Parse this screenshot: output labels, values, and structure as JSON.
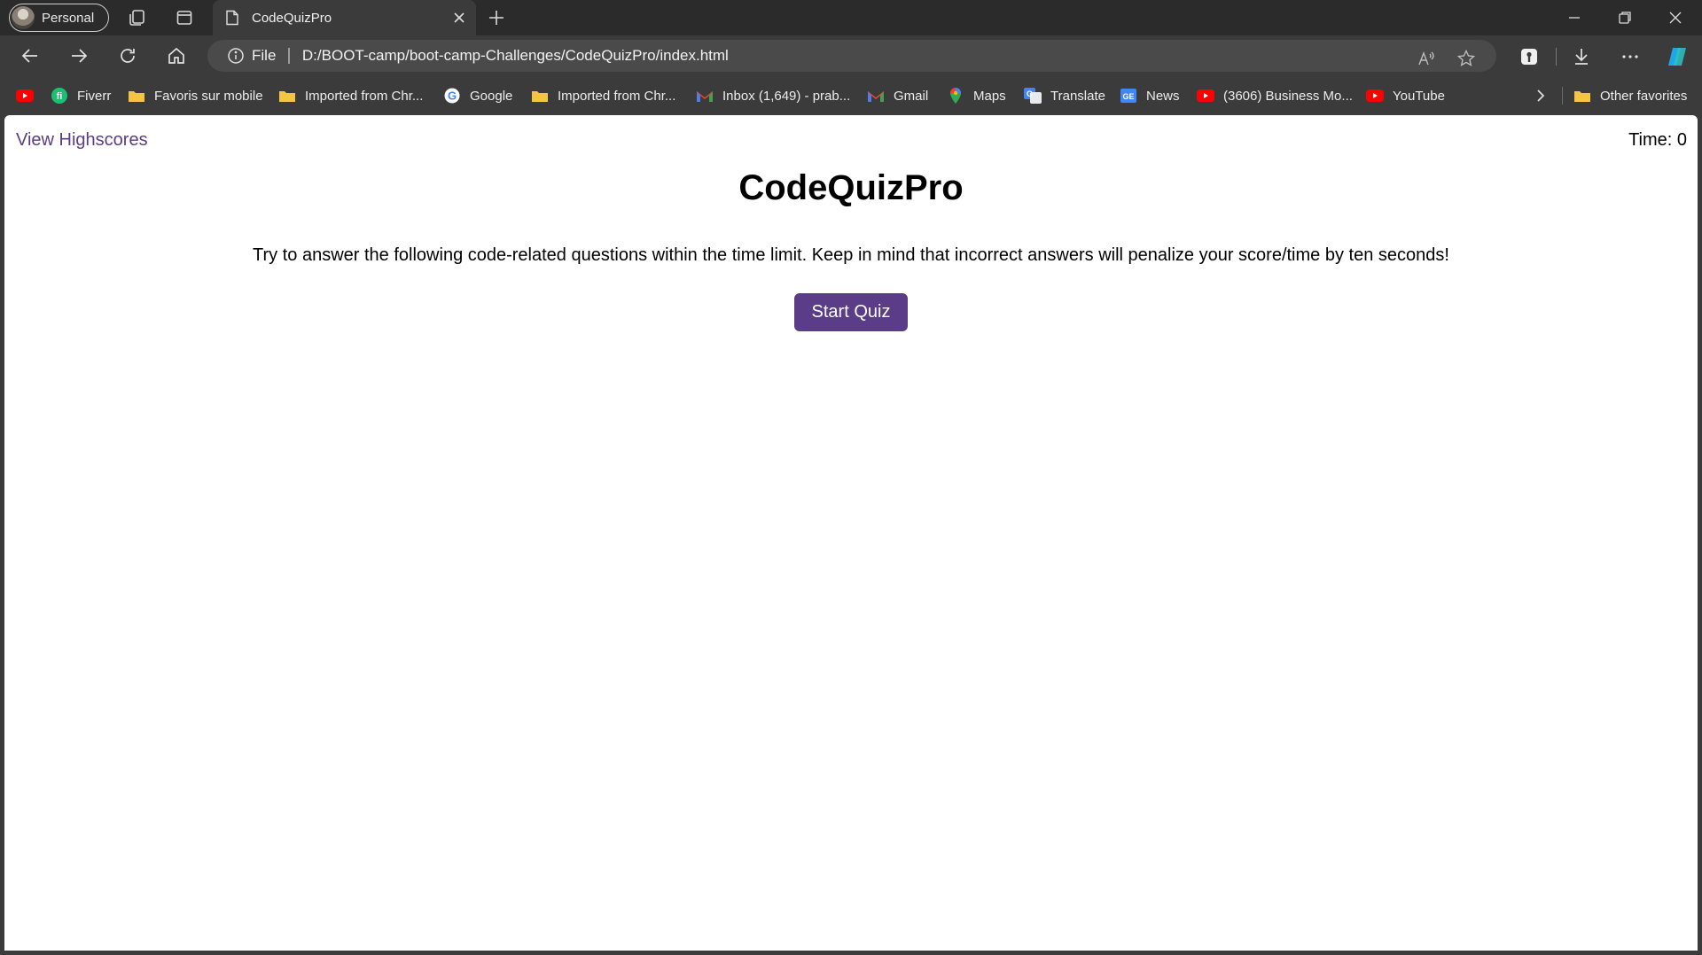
{
  "browser": {
    "profile_label": "Personal",
    "tab_title": "CodeQuizPro",
    "address": {
      "scheme_label": "File",
      "url": "D:/BOOT-camp/boot-camp-Challenges/CodeQuizPro/index.html"
    },
    "bookmarks": [
      {
        "label": "",
        "icon": "youtube-icon"
      },
      {
        "label": "Fiverr",
        "icon": "fiverr-icon"
      },
      {
        "label": "Favoris sur mobile",
        "icon": "folder-icon"
      },
      {
        "label": "Imported from Chr...",
        "icon": "folder-icon"
      },
      {
        "label": "Google",
        "icon": "google-icon"
      },
      {
        "label": "Imported from Chr...",
        "icon": "folder-icon"
      },
      {
        "label": "Inbox (1,649) - prab...",
        "icon": "gmail-icon"
      },
      {
        "label": "Gmail",
        "icon": "gmail-icon"
      },
      {
        "label": "Maps",
        "icon": "maps-icon"
      },
      {
        "label": "Translate",
        "icon": "translate-icon"
      },
      {
        "label": "News",
        "icon": "news-icon"
      },
      {
        "label": "(3606) Business Mo...",
        "icon": "youtube-icon"
      },
      {
        "label": "YouTube",
        "icon": "youtube-icon"
      }
    ],
    "other_favorites_label": "Other favorites"
  },
  "page": {
    "highscores_link": "View Highscores",
    "timer_text": "Time: 0",
    "title": "CodeQuizPro",
    "description": "Try to answer the following code-related questions within the time limit. Keep in mind that incorrect answers will penalize your score/time by ten seconds!",
    "start_button": "Start Quiz"
  },
  "colors": {
    "accent": "#5b3c88",
    "chrome_dark": "#2b2b2b",
    "chrome_mid": "#3b3b3b"
  }
}
